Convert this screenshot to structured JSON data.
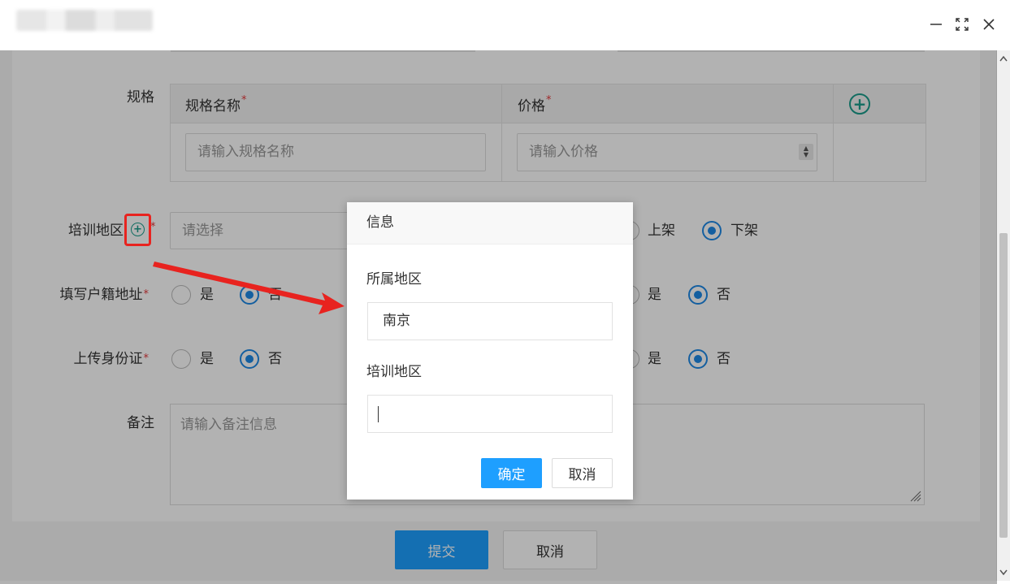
{
  "window": {
    "min_icon": "minimize-icon",
    "max_icon": "maximize-icon",
    "close_icon": "close-icon"
  },
  "form": {
    "spec_label": "规格",
    "spec_table": {
      "col_name": "规格名称",
      "col_price": "价格",
      "name_placeholder": "请输入规格名称",
      "price_placeholder": "请输入价格"
    },
    "region_label": "培训地区",
    "region_placeholder": "请选择",
    "shelf": {
      "on_label": "上架",
      "off_label": "下架"
    },
    "address_label": "填写户籍地址",
    "id_label": "上传身份证",
    "yes": "是",
    "no": "否",
    "remark_label": "备注",
    "remark_placeholder": "请输入备注信息",
    "submit": "提交",
    "cancel": "取消",
    "required_mark": "*"
  },
  "modal": {
    "title": "信息",
    "region_label": "所属地区",
    "region_value": "南京",
    "training_label": "培训地区",
    "training_value": "",
    "ok": "确定",
    "cancel": "取消"
  },
  "colors": {
    "accent": "#1e9fff",
    "radio": "#1e88e5",
    "annotation": "#e8231f",
    "plus": "#1a9c8c"
  }
}
